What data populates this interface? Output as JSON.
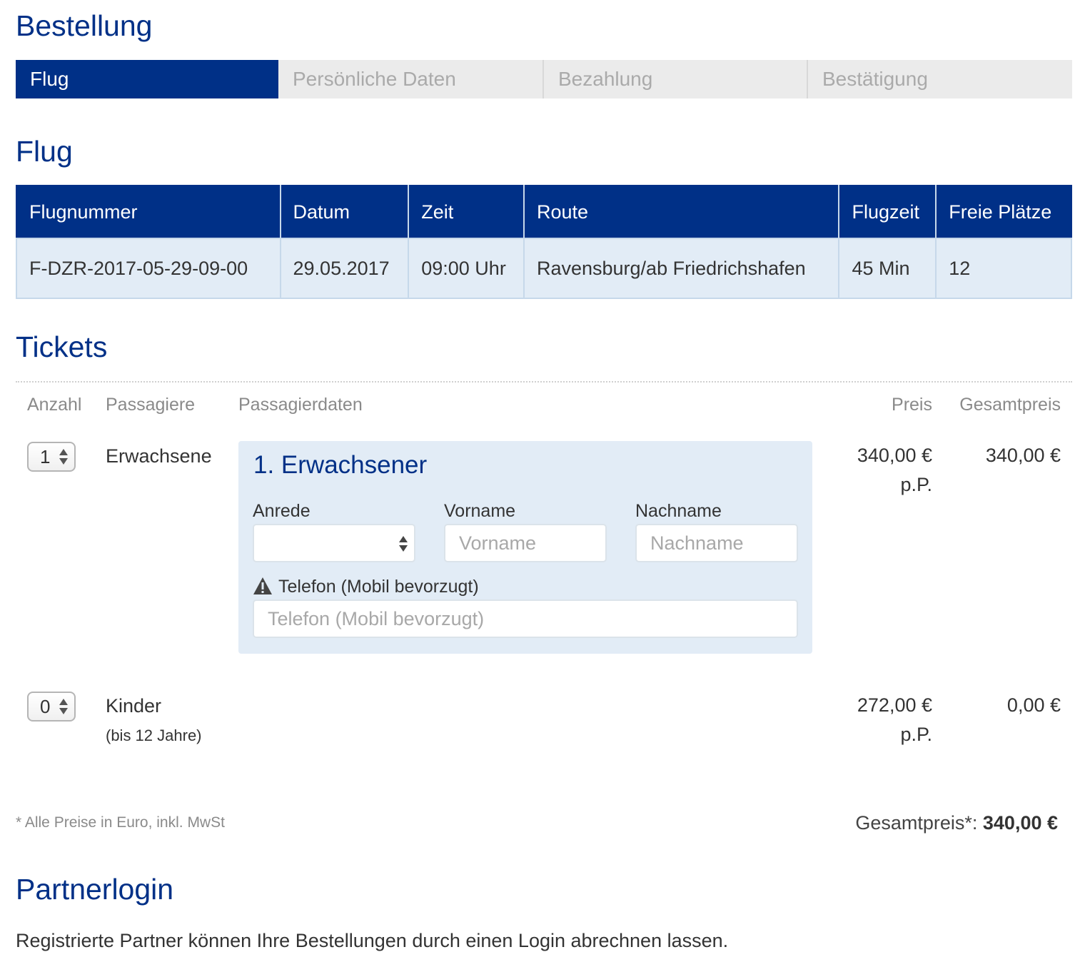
{
  "page": {
    "title": "Bestellung"
  },
  "steps": [
    {
      "label": "Flug",
      "active": true
    },
    {
      "label": "Persönliche Daten",
      "active": false
    },
    {
      "label": "Bezahlung",
      "active": false
    },
    {
      "label": "Bestätigung",
      "active": false
    }
  ],
  "flight": {
    "heading": "Flug",
    "columns": [
      "Flugnummer",
      "Datum",
      "Zeit",
      "Route",
      "Flugzeit",
      "Freie Plätze"
    ],
    "row": [
      "F-DZR-2017-05-29-09-00",
      "29.05.2017",
      "09:00 Uhr",
      "Ravensburg/ab Friedrichshafen",
      "45 Min",
      "12"
    ]
  },
  "tickets": {
    "heading": "Tickets",
    "columns": {
      "count": "Anzahl",
      "passengers": "Passagiere",
      "passenger_data": "Passagierdaten",
      "price": "Preis",
      "total": "Gesamtpreis"
    },
    "adults": {
      "count": "1",
      "label": "Erwachsene",
      "price": "340,00 €",
      "price_unit": "p.P.",
      "total": "340,00 €"
    },
    "children": {
      "count": "0",
      "label": "Kinder",
      "sublabel": "(bis 12 Jahre)",
      "price": "272,00 €",
      "price_unit": "p.P.",
      "total": "0,00 €"
    },
    "passenger_form": {
      "title": "1. Erwachsener",
      "salutation_label": "Anrede",
      "salutation_value": "",
      "firstname_label": "Vorname",
      "firstname_placeholder": "Vorname",
      "lastname_label": "Nachname",
      "lastname_placeholder": "Nachname",
      "phone_label": "Telefon (Mobil bevorzugt)",
      "phone_placeholder": "Telefon (Mobil bevorzugt)"
    },
    "footnote": "* Alle Preise in Euro, inkl. MwSt",
    "grand_total_label": "Gesamtpreis*:",
    "grand_total_value": "340,00 €"
  },
  "partner": {
    "heading": "Partnerlogin",
    "text": "Registrierte Partner können Ihre Bestellungen durch einen Login abrechnen lassen."
  },
  "colors": {
    "primary": "#003087",
    "table_row_bg": "#e2ecf6",
    "step_inactive_bg": "#ebebeb",
    "muted_text": "#8a8a8a"
  }
}
